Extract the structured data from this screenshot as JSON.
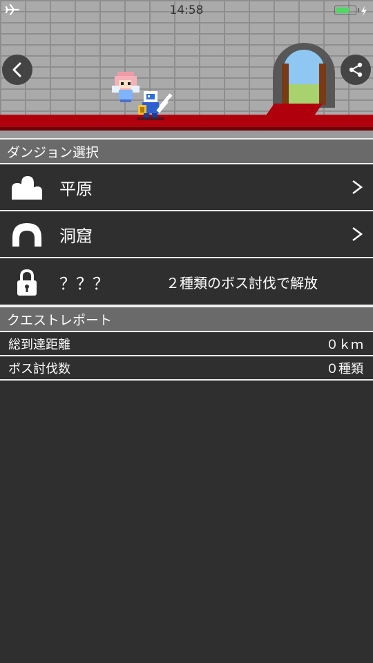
{
  "status_bar": {
    "time": "14:58",
    "airplane_icon": "airplane-icon",
    "battery_level": 0.7,
    "battery_color": "#4cd964"
  },
  "scene": {
    "back_icon": "chevron-left-icon",
    "share_icon": "share-icon",
    "carpet_color": "#b0000e"
  },
  "dungeon_section": {
    "title": "ダンジョン選択",
    "items": [
      {
        "label": "平原",
        "icon": "plains-icon",
        "chevron": ">"
      },
      {
        "label": "洞窟",
        "icon": "cave-icon",
        "chevron": ">"
      },
      {
        "label": "？？？",
        "icon": "lock-icon",
        "unlock_text": "２種類のボス討伐で解放"
      }
    ]
  },
  "report_section": {
    "title": "クエストレポート",
    "stats": [
      {
        "label": "総到達距離",
        "value": "０ｋｍ"
      },
      {
        "label": "ボス討伐数",
        "value": "０種類"
      }
    ]
  }
}
